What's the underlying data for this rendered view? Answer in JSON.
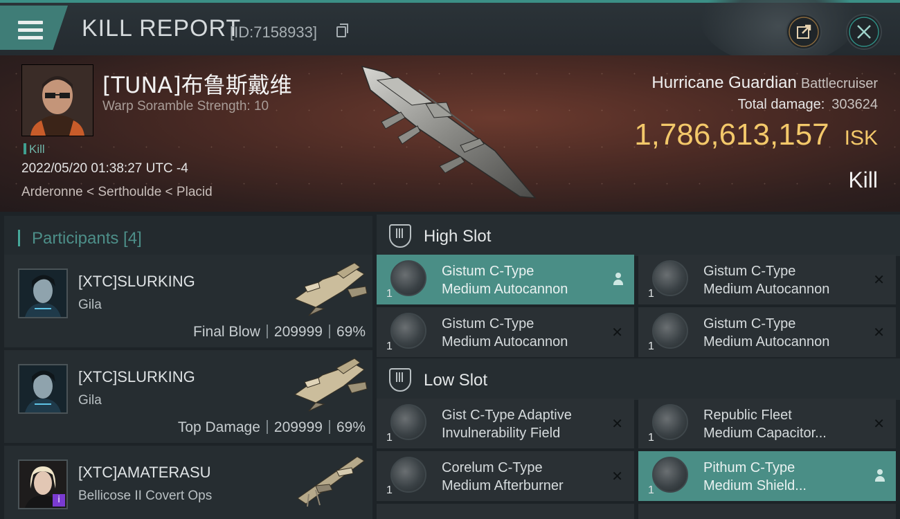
{
  "header": {
    "title": "KILL REPORT",
    "report_id": "[ID:7158933]"
  },
  "victim": {
    "name": "[TUNA]布鲁斯戴维",
    "subtitle": "Warp Soramble Strength: 10",
    "tag": "Kill",
    "datetime": "2022/05/20 01:38:27 UTC -4",
    "location": "Arderonne < Serthoulde < Placid"
  },
  "ship": {
    "name": "Hurricane Guardian",
    "class": "Battlecruiser",
    "total_damage_label": "Total damage:",
    "total_damage": "303624",
    "value": "1,786,613,157",
    "currency": "ISK",
    "result": "Kill"
  },
  "participants": {
    "title": "Participants [4]",
    "items": [
      {
        "name": "[XTC]SLURKING",
        "ship": "Gila",
        "role": "Final Blow",
        "damage": "209999",
        "percent": "69%"
      },
      {
        "name": "[XTC]SLURKING",
        "ship": "Gila",
        "role": "Top Damage",
        "damage": "209999",
        "percent": "69%"
      },
      {
        "name": "[XTC]AMATERASU",
        "ship": "Bellicose II Covert Ops",
        "badge": "i"
      }
    ]
  },
  "slots": {
    "high": {
      "title": "High Slot",
      "modules": [
        {
          "line1": "Gistum C-Type",
          "line2": "Medium Autocannon",
          "qty": "1",
          "icon": "autocannon-icon",
          "active": true
        },
        {
          "line1": "Gistum C-Type",
          "line2": "Medium Autocannon",
          "qty": "1",
          "icon": "autocannon-icon",
          "active": false
        },
        {
          "line1": "Gistum C-Type",
          "line2": "Medium Autocannon",
          "qty": "1",
          "icon": "autocannon-icon",
          "active": false
        },
        {
          "line1": "Gistum C-Type",
          "line2": "Medium Autocannon",
          "qty": "1",
          "icon": "autocannon-icon",
          "active": false
        }
      ]
    },
    "low": {
      "title": "Low Slot",
      "modules": [
        {
          "line1": "Gist C-Type Adaptive",
          "line2": "Invulnerability Field",
          "qty": "1",
          "icon": "invulnerability-field-icon",
          "active": false
        },
        {
          "line1": "Republic Fleet",
          "line2": "Medium Capacitor...",
          "qty": "1",
          "icon": "capacitor-booster-icon",
          "active": false
        },
        {
          "line1": "Corelum C-Type",
          "line2": "Medium Afterburner",
          "qty": "1",
          "icon": "afterburner-icon",
          "active": false
        },
        {
          "line1": "Pithum C-Type",
          "line2": "Medium Shield...",
          "qty": "1",
          "icon": "shield-booster-icon",
          "active": true
        }
      ]
    }
  },
  "colors": {
    "accent": "#3f7d77",
    "active_row": "#4a8e86",
    "isk_gold": "#f3c86a"
  }
}
